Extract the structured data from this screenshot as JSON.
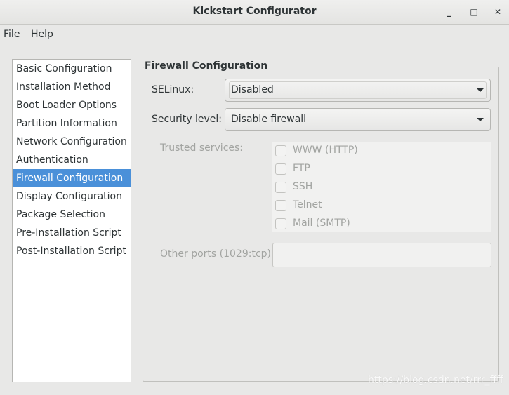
{
  "window": {
    "title": "Kickstart Configurator",
    "minimize": "_",
    "maximize": "□",
    "close": "✕"
  },
  "menubar": {
    "file": "File",
    "help": "Help"
  },
  "sidebar": {
    "items": [
      {
        "label": "Basic Configuration"
      },
      {
        "label": "Installation Method"
      },
      {
        "label": "Boot Loader Options"
      },
      {
        "label": "Partition Information"
      },
      {
        "label": "Network Configuration"
      },
      {
        "label": "Authentication"
      },
      {
        "label": "Firewall Configuration",
        "selected": true
      },
      {
        "label": "Display Configuration"
      },
      {
        "label": "Package Selection"
      },
      {
        "label": "Pre-Installation Script"
      },
      {
        "label": "Post-Installation Script"
      }
    ]
  },
  "firewall": {
    "title": "Firewall Configuration",
    "selinux_label": "SELinux:",
    "selinux_value": "Disabled",
    "security_label": "Security level:",
    "security_value": "Disable firewall",
    "trusted_label": "Trusted services:",
    "services": [
      {
        "label": "WWW (HTTP)",
        "checked": false
      },
      {
        "label": "FTP",
        "checked": false
      },
      {
        "label": "SSH",
        "checked": false
      },
      {
        "label": "Telnet",
        "checked": false
      },
      {
        "label": "Mail (SMTP)",
        "checked": false
      }
    ],
    "ports_label": "Other ports (1029:tcp):",
    "ports_value": ""
  },
  "watermark": "https://blog.csdn.net/rrr_ffff",
  "colors": {
    "selection": "#4a90d9"
  }
}
